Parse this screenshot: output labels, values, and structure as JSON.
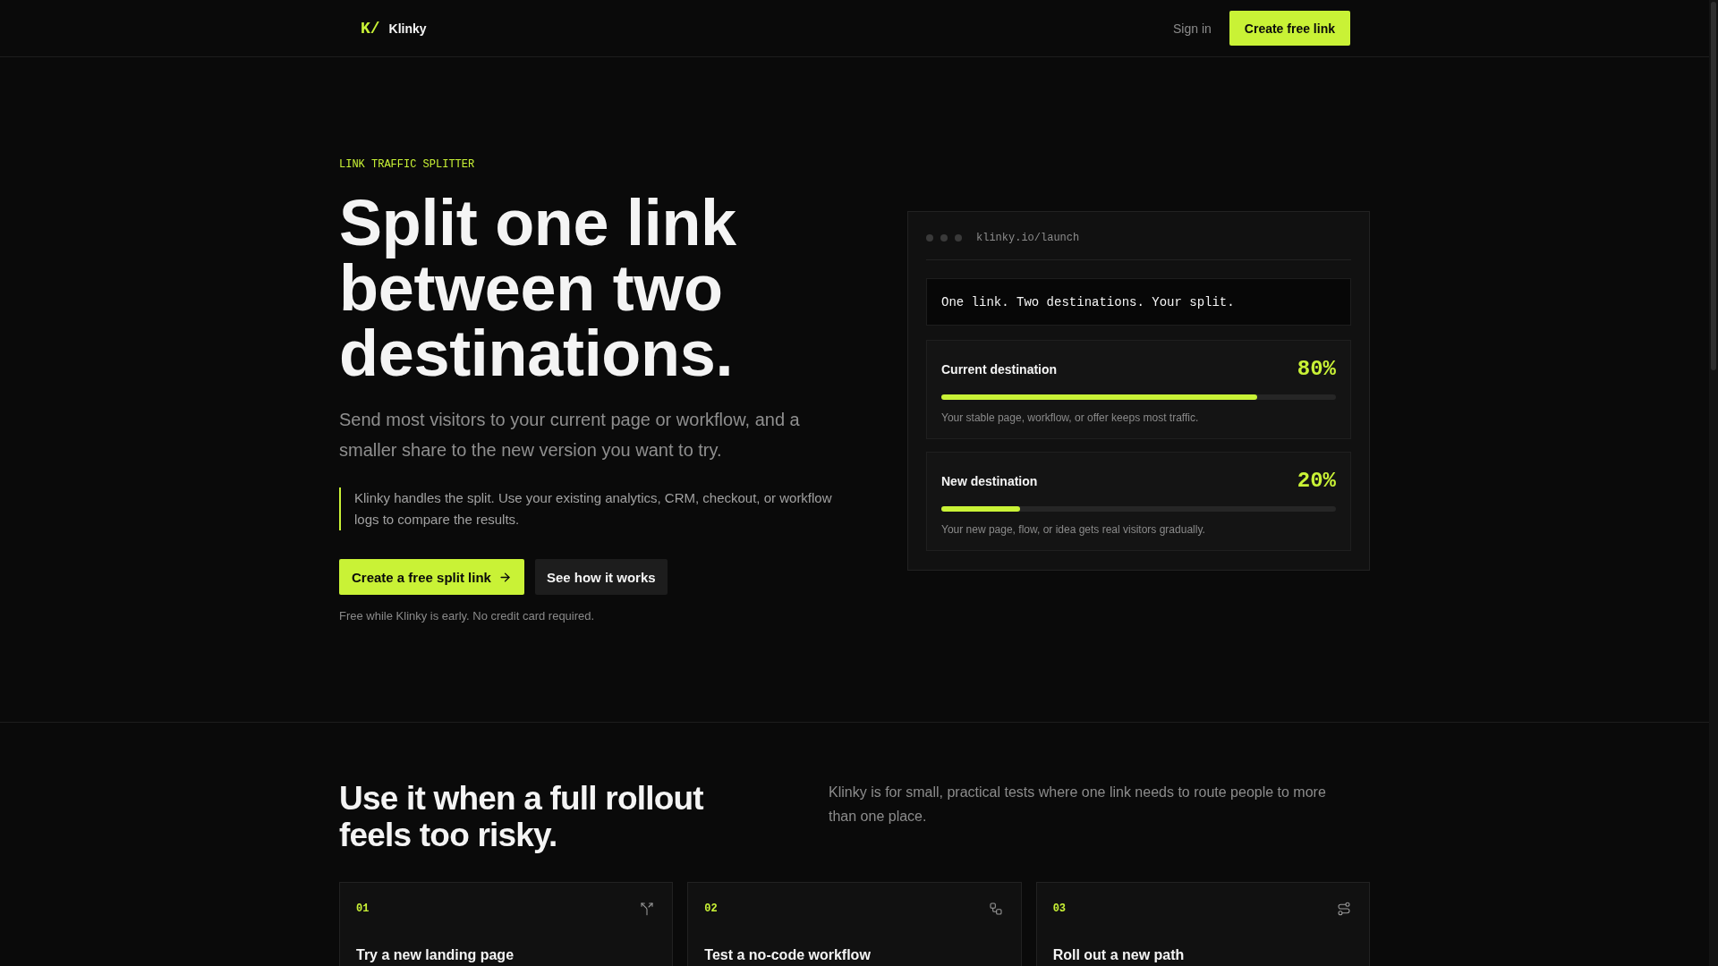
{
  "header": {
    "logo_mark": "K/",
    "brand": "Klinky",
    "sign_in": "Sign in",
    "cta": "Create free link"
  },
  "hero": {
    "eyebrow": "LINK TRAFFIC SPLITTER",
    "title": "Split one link between two destinations.",
    "subtitle": "Send most visitors to your current page or workflow, and a smaller share to the new version you want to try.",
    "note": "Klinky handles the split. Use your existing analytics, CRM, checkout, or workflow logs to compare the results.",
    "buttons": [
      {
        "label": "Create a free split link",
        "kind": "primary"
      },
      {
        "label": "See how it works",
        "kind": "secondary"
      }
    ],
    "fine_print": "Free while Klinky is early. No credit card required."
  },
  "preview": {
    "url": "klinky.io/launch",
    "tagline": "One link. Two destinations. Your split.",
    "destinations": [
      {
        "name": "Current destination",
        "share": "80%",
        "level": 0.8,
        "description": "Your stable page, workflow, or offer keeps most traffic."
      },
      {
        "name": "New destination",
        "share": "20%",
        "level": 0.2,
        "description": "Your new page, flow, or idea gets real visitors gradually."
      }
    ]
  },
  "use_cases": {
    "title": "Use it when a full rollout feels too risky.",
    "intro": "Klinky is for small, practical tests where one link needs to route people to more than one place.",
    "cards": [
      {
        "number": "01",
        "title": "Try a new landing page"
      },
      {
        "number": "02",
        "title": "Test a no-code workflow"
      },
      {
        "number": "03",
        "title": "Roll out a new path"
      }
    ]
  }
}
